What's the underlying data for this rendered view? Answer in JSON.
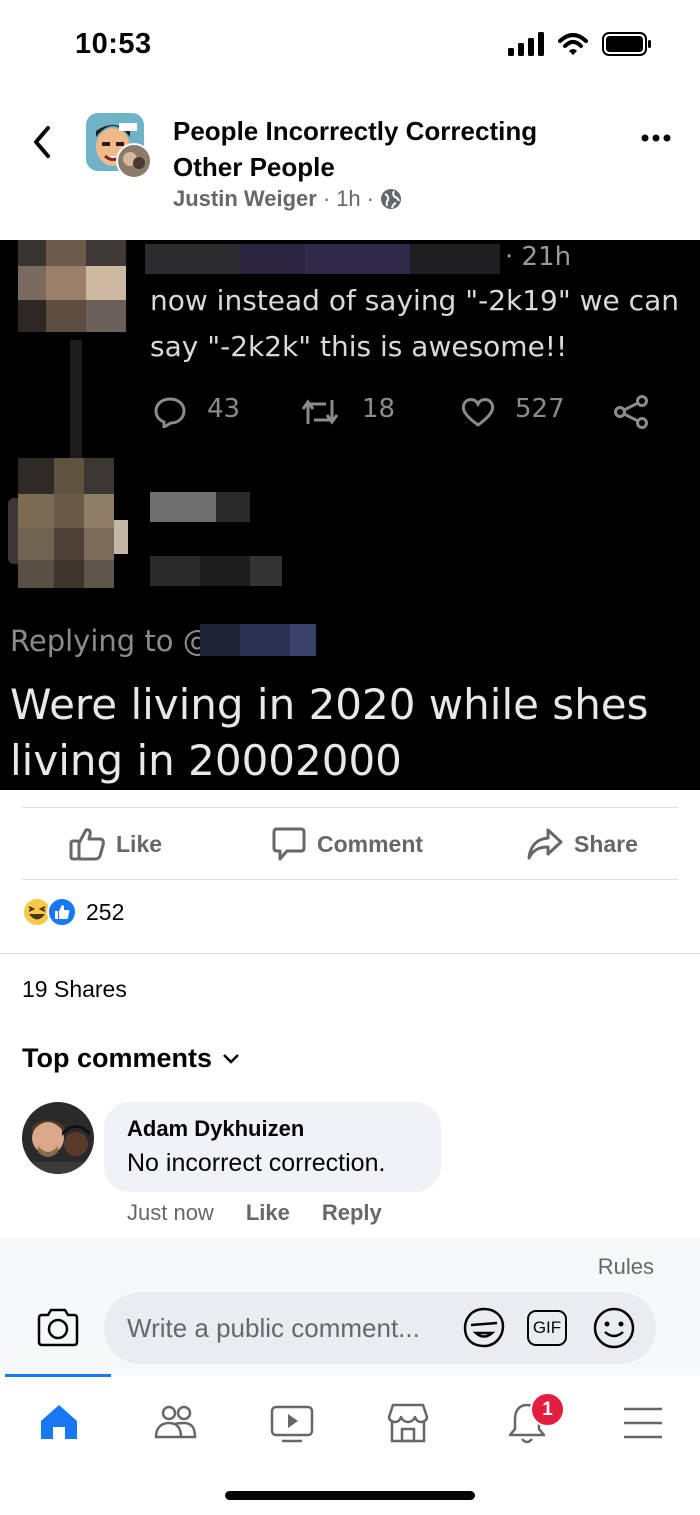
{
  "status_bar": {
    "time": "10:53"
  },
  "header": {
    "group_name": "People Incorrectly Correcting Other People",
    "author": "Justin Weiger",
    "separator": "·",
    "time_ago": "1h",
    "separator2": "·"
  },
  "post_image": {
    "tweet_time": "· 21h",
    "tweet_text_line1": "now instead of saying \"-2k19\" we can",
    "tweet_text_line2": "say \"-2k2k\" this is awesome!!",
    "replies": "43",
    "retweets": "18",
    "likes": "527",
    "replying_to": "Replying to @",
    "reply_line1": "Were living in 2020 while shes",
    "reply_line2": "living in 20002000"
  },
  "actions": {
    "like": "Like",
    "comment": "Comment",
    "share": "Share"
  },
  "reactions": {
    "count": "252"
  },
  "shares": "19 Shares",
  "comments_header": "Top comments",
  "comment": {
    "author": "Adam Dykhuizen",
    "text": "No incorrect correction.",
    "time": "Just now",
    "like": "Like",
    "reply": "Reply"
  },
  "composer": {
    "rules": "Rules",
    "placeholder": "Write a public comment...",
    "gif": "GIF"
  },
  "tabbar": {
    "notifications_badge": "1"
  },
  "colors": {
    "accent": "#1877f2",
    "badge": "#e41e3f",
    "secondary_text": "#65676b"
  }
}
